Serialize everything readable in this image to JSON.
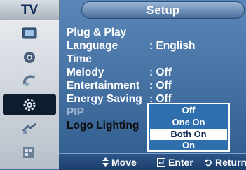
{
  "header": {
    "source_tab": "TV",
    "menu_title": "Setup"
  },
  "sidebar": {
    "items": [
      {
        "icon": "picture-icon"
      },
      {
        "icon": "sound-icon"
      },
      {
        "icon": "channel-icon"
      },
      {
        "icon": "setup-gear-icon",
        "selected": true
      },
      {
        "icon": "input-icon"
      },
      {
        "icon": "application-icon"
      }
    ]
  },
  "menu": {
    "items": [
      {
        "label": "Plug & Play",
        "value": ""
      },
      {
        "label": "Language",
        "value": ": English"
      },
      {
        "label": "Time",
        "value": ""
      },
      {
        "label": "Melody",
        "value": ": Off"
      },
      {
        "label": "Entertainment",
        "value": ": Off"
      },
      {
        "label": "Energy Saving",
        "value": ": Off"
      },
      {
        "label": "PIP",
        "value": ""
      },
      {
        "label": "Logo Lighting",
        "value": ":"
      }
    ]
  },
  "dropdown": {
    "options": [
      "Off",
      "One On",
      "Both On",
      "On"
    ],
    "selected": "Both On"
  },
  "footer": {
    "move_label": "Move",
    "enter_label": "Enter",
    "return_label": "Return"
  },
  "colors": {
    "accent": "#2f6fae",
    "selected_bg": "#ffffff",
    "selected_text": "#0d2a52"
  }
}
